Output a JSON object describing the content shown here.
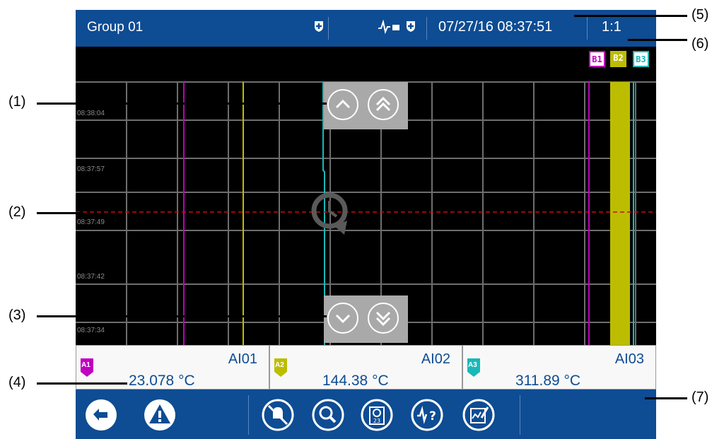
{
  "header": {
    "title": "Group 01",
    "datetime": "07/27/16 08:37:51",
    "zoom": "1:1",
    "icons": [
      "shield-plus-icon",
      "pulse-icon",
      "shield-plus-icon"
    ]
  },
  "trend": {
    "time_labels": [
      "08:38:04",
      "08:37:57",
      "08:37:49",
      "08:37:42",
      "08:37:34"
    ],
    "markers": [
      {
        "label": "B1",
        "color": "#c000c0"
      },
      {
        "label": "B2",
        "color": "#bdbd00"
      },
      {
        "label": "B3",
        "color": "#19b8b8"
      }
    ],
    "scroll_up_icons": [
      "chevron-up-icon",
      "double-chevron-up-icon"
    ],
    "scroll_down_icons": [
      "chevron-down-icon",
      "double-chevron-down-icon"
    ],
    "center_icon": "clock-replay-icon"
  },
  "channels": [
    {
      "tag": "A1",
      "name": "AI01",
      "value": "23.078 °C",
      "color": "#c000c0"
    },
    {
      "tag": "A2",
      "name": "AI02",
      "value": "144.38 °C",
      "color": "#bdbd00"
    },
    {
      "tag": "A3",
      "name": "AI03",
      "value": "311.89 °C",
      "color": "#19b8b8"
    }
  ],
  "bottombar": {
    "icons": [
      "back-icon",
      "warning-icon",
      "mute-alarm-icon",
      "search-icon",
      "calendar-clock-icon",
      "signal-help-icon",
      "chart-edit-icon"
    ]
  },
  "callouts": [
    "(1)",
    "(2)",
    "(3)",
    "(4)",
    "(5)",
    "(6)",
    "(7)"
  ]
}
